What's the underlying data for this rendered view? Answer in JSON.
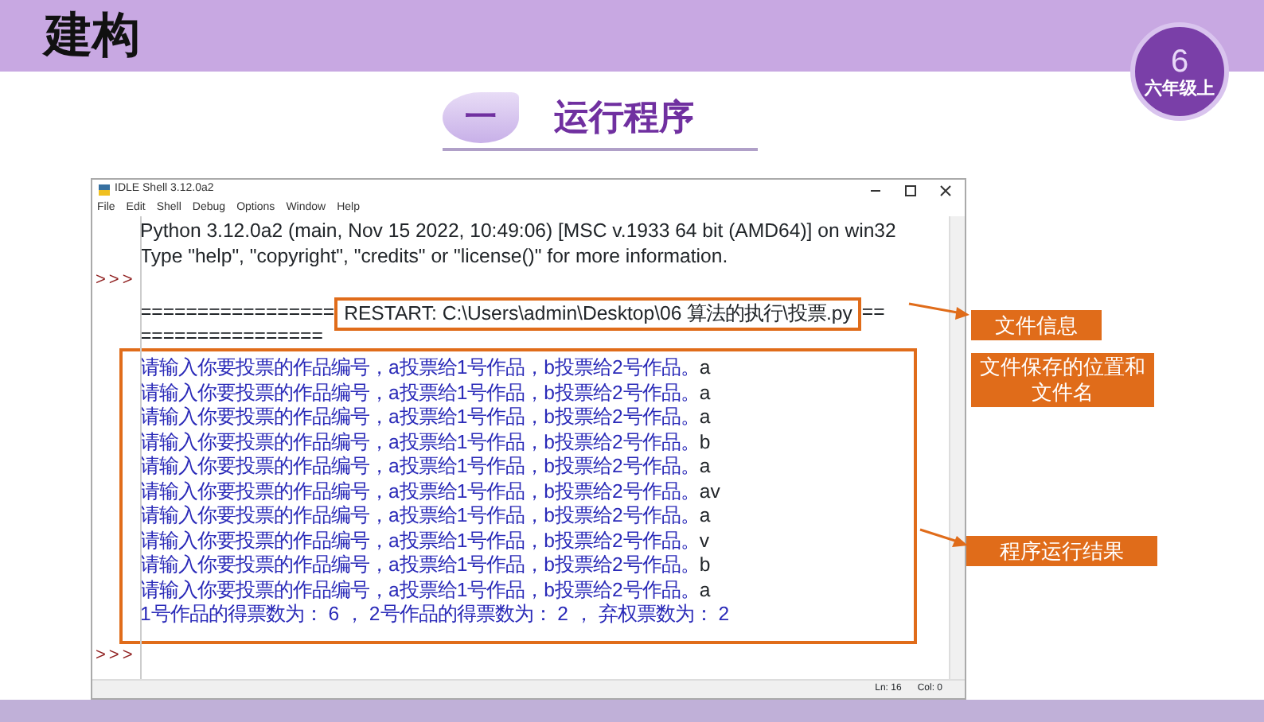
{
  "header": {
    "title": "建构",
    "badge": {
      "number": "6",
      "grade": "六年级上"
    }
  },
  "section": {
    "number": "一",
    "title": "运行程序"
  },
  "idle": {
    "title": "IDLE Shell 3.12.0a2",
    "menu": [
      "File",
      "Edit",
      "Shell",
      "Debug",
      "Options",
      "Window",
      "Help"
    ],
    "lines": [
      {
        "kind": "output",
        "text": "Python 3.12.0a2 (main, Nov 15 2022, 10:49:06) [MSC v.1933 64 bit (AMD64)] on win32"
      },
      {
        "kind": "output",
        "text": "Type \"help\", \"copyright\", \"credits\" or \"license()\" for more information."
      },
      {
        "kind": "prompt",
        "prompt": ">>>"
      },
      {
        "kind": "restart",
        "prefix": "=================",
        "text": "RESTART: C:\\Users\\admin\\Desktop\\06 算法的执行\\投票.py",
        "suffix": "=="
      },
      {
        "kind": "output",
        "text": "================"
      }
    ],
    "results": [
      {
        "question": "请输入你要投票的作品编号，a投票给1号作品，b投票给2号作品。",
        "answer": "a"
      },
      {
        "question": "请输入你要投票的作品编号，a投票给1号作品，b投票给2号作品。",
        "answer": "a"
      },
      {
        "question": "请输入你要投票的作品编号，a投票给1号作品，b投票给2号作品。",
        "answer": "a"
      },
      {
        "question": "请输入你要投票的作品编号，a投票给1号作品，b投票给2号作品。",
        "answer": "b"
      },
      {
        "question": "请输入你要投票的作品编号，a投票给1号作品，b投票给2号作品。",
        "answer": "a"
      },
      {
        "question": "请输入你要投票的作品编号，a投票给1号作品，b投票给2号作品。",
        "answer": "av"
      },
      {
        "question": "请输入你要投票的作品编号，a投票给1号作品，b投票给2号作品。",
        "answer": "a"
      },
      {
        "question": "请输入你要投票的作品编号，a投票给1号作品，b投票给2号作品。",
        "answer": "v"
      },
      {
        "question": "请输入你要投票的作品编号，a投票给1号作品，b投票给2号作品。",
        "answer": "b"
      },
      {
        "question": "请输入你要投票的作品编号，a投票给1号作品，b投票给2号作品。",
        "answer": "a"
      }
    ],
    "summary": "1号作品的得票数为： 6 ， 2号作品的得票数为： 2 ， 弃权票数为： 2",
    "final_prompt": ">>>",
    "status": [
      "Ln: 16",
      "Col: 0"
    ]
  },
  "annotations": [
    "文件信息",
    "文件保存的位置和文件名",
    "程序运行结果"
  ]
}
